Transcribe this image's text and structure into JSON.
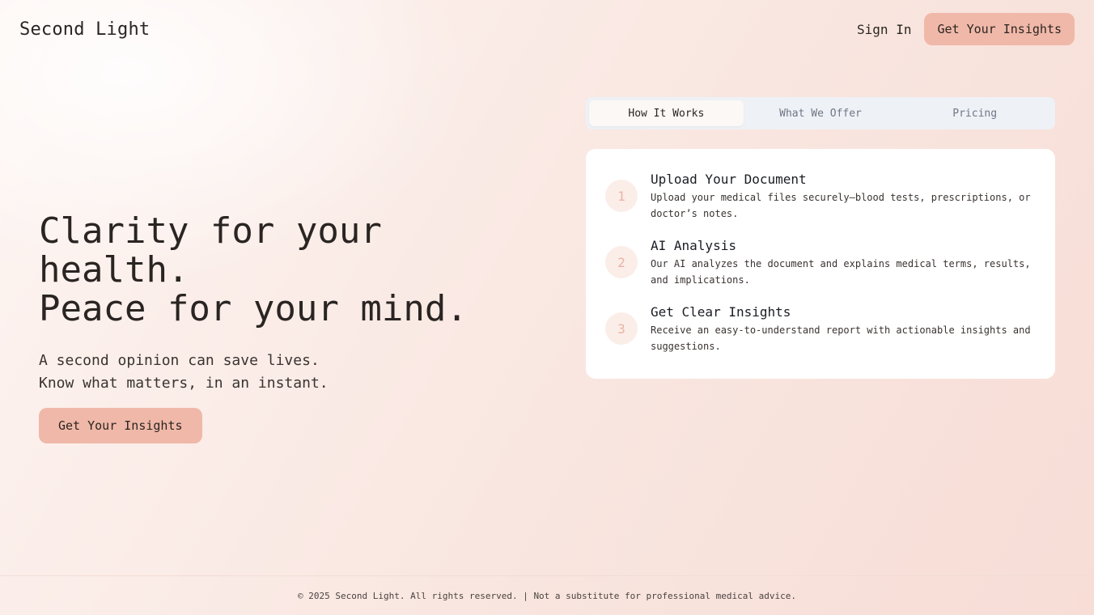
{
  "header": {
    "brand": "Second Light",
    "sign_in": "Sign In",
    "cta": "Get Your Insights"
  },
  "hero": {
    "title_line1": "Clarity for your health.",
    "title_line2": "Peace for your mind.",
    "sub_line1": "A second opinion can save lives.",
    "sub_line2": "Know what matters, in an instant.",
    "cta": "Get Your Insights"
  },
  "tabs": [
    {
      "label": "How It Works",
      "active": true
    },
    {
      "label": "What We Offer",
      "active": false
    },
    {
      "label": "Pricing",
      "active": false
    }
  ],
  "steps": [
    {
      "num": "1",
      "title": "Upload Your Document",
      "desc": "Upload your medical files securely—blood tests, prescriptions, or doctor’s notes."
    },
    {
      "num": "2",
      "title": "AI Analysis",
      "desc": "Our AI analyzes the document and explains medical terms, results, and implications."
    },
    {
      "num": "3",
      "title": "Get Clear Insights",
      "desc": "Receive an easy-to-understand report with actionable insights and suggestions."
    }
  ],
  "footer": {
    "text": "© 2025 Second Light. All rights reserved. | Not a substitute for professional medical advice."
  },
  "colors": {
    "accent": "#f0b8a8",
    "step_circle": "#fbeee9",
    "tabs_bg": "#eef1f6"
  }
}
